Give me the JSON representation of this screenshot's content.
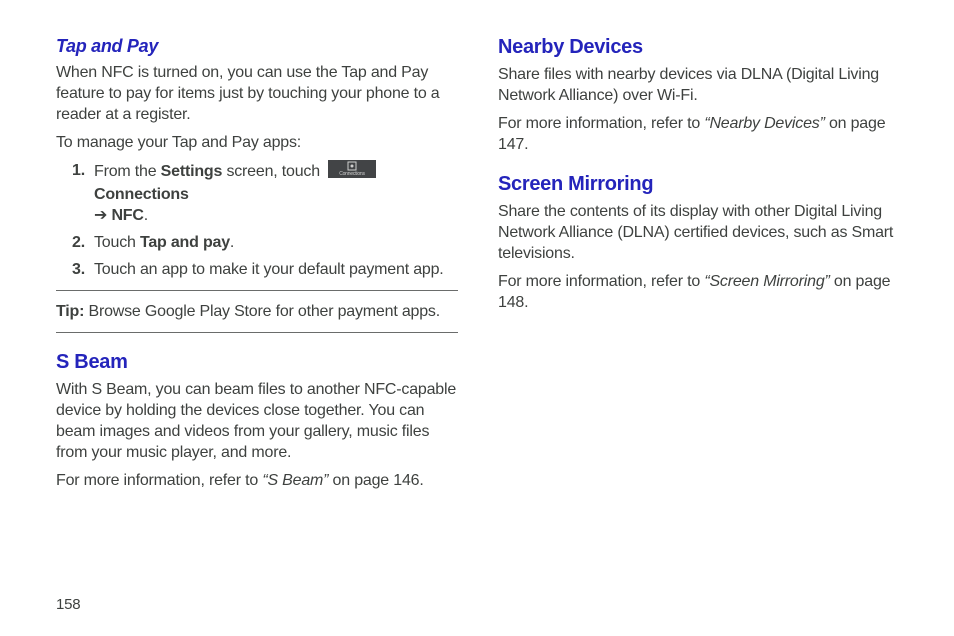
{
  "left": {
    "tapAndPay": {
      "title": "Tap and Pay",
      "p1": "When NFC is turned on, you can use the Tap and Pay feature to pay for items just by touching your phone to a reader at a register.",
      "p2": "To manage your Tap and Pay apps:",
      "steps": {
        "n1": "1.",
        "s1a": "From the ",
        "s1b": "Settings",
        "s1c": " screen, touch ",
        "s1d": " Connections",
        "s1arrow": "➔ ",
        "s1e": "NFC",
        "s1f": ".",
        "n2": "2.",
        "s2a": "Touch ",
        "s2b": "Tap and pay",
        "s2c": ".",
        "n3": "3.",
        "s3": "Touch an app to make it your default payment app."
      },
      "tipLabel": "Tip:",
      "tipBody": " Browse Google Play Store for other payment apps."
    },
    "sbeam": {
      "title": "S Beam",
      "p1": "With S Beam, you can beam files to another NFC-capable device by holding the devices close together. You can beam images and videos from your gallery, music files from your music player, and more.",
      "p2a": "For more information, refer to ",
      "p2b": "“S Beam”",
      "p2c": " on page 146."
    }
  },
  "right": {
    "nearby": {
      "title": "Nearby Devices",
      "p1": "Share files with nearby devices via DLNA (Digital Living Network Alliance) over Wi-Fi.",
      "p2a": "For more information, refer to ",
      "p2b": "“Nearby Devices”",
      "p2c": " on page 147."
    },
    "mirroring": {
      "title": "Screen Mirroring",
      "p1": "Share the contents of its display with other Digital Living Network Alliance (DLNA) certified devices, such as Smart televisions.",
      "p2a": "For more information, refer to ",
      "p2b": "“Screen Mirroring”",
      "p2c": " on page 148."
    }
  },
  "pageNumber": "158"
}
